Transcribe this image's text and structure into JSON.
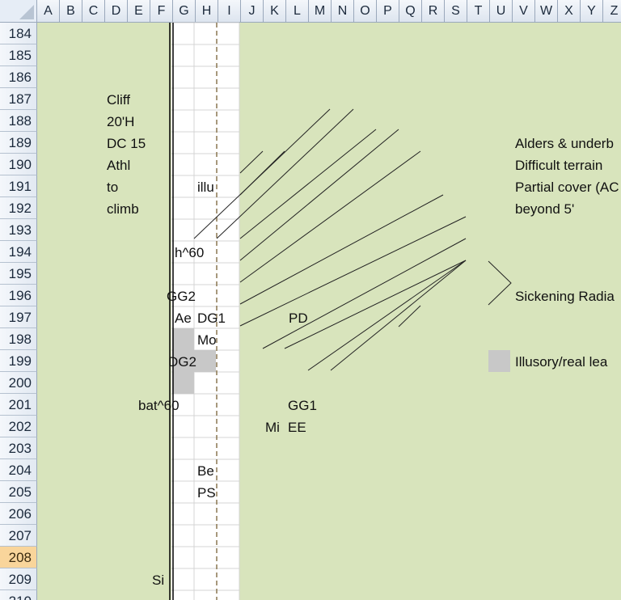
{
  "columns": [
    "A",
    "B",
    "C",
    "D",
    "E",
    "F",
    "G",
    "H",
    "I",
    "J",
    "K",
    "L",
    "M",
    "N",
    "O",
    "P",
    "Q",
    "R",
    "S",
    "T",
    "U",
    "V",
    "W",
    "X",
    "Y",
    "Z"
  ],
  "rows": [
    "184",
    "185",
    "186",
    "187",
    "188",
    "189",
    "190",
    "191",
    "192",
    "193",
    "194",
    "195",
    "196",
    "197",
    "198",
    "199",
    "200",
    "201",
    "202",
    "203",
    "204",
    "205",
    "206",
    "207",
    "208",
    "209",
    "210"
  ],
  "selected_row": "208",
  "colors": {
    "background": "#d8e4bc",
    "white_strip": "#ffffff",
    "gray_cell": "#c8c8c8",
    "header_selected": "#f9d59b",
    "dashed_line": "#8a7750"
  },
  "cliff_label": [
    "Cliff",
    "20'H",
    "DC 15",
    "Athl",
    "to",
    "climb"
  ],
  "strip_labels": {
    "illu": "illu",
    "h60": "h^60",
    "gg2": "GG2",
    "ae": "Ae",
    "dg1": "DG1",
    "mo": "Mo",
    "dg2": "DG2",
    "bat60": "bat^60",
    "be": "Be",
    "ps": "PS",
    "si": "Si"
  },
  "field_labels": {
    "pd": "PD",
    "gg1": "GG1",
    "mi": "Mi",
    "ee": "EE"
  },
  "legend": {
    "alders": [
      "Alders & underb",
      "Difficult terrain",
      "Partial cover (AC",
      "beyond 5'"
    ],
    "sickening": "Sickening Radia",
    "illusory": "Illusory/real lea"
  }
}
